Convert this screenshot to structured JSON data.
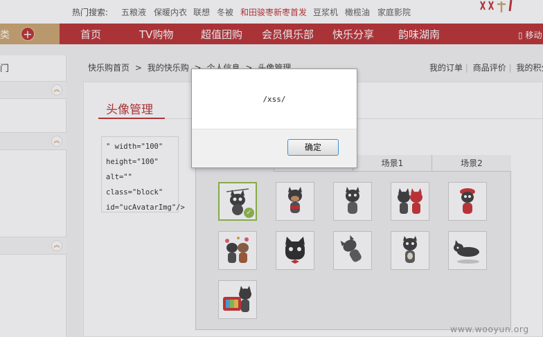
{
  "hotbar": {
    "label": "热门搜索:",
    "links": [
      "五粮液",
      "保暖内衣",
      "联想",
      "冬被",
      "和田骏枣新枣首发",
      "豆浆机",
      "橄榄油",
      "家庭影院"
    ]
  },
  "navbar": {
    "category_text": "类",
    "plus": "+",
    "items": [
      "首页",
      "TV购物",
      "超值团购",
      "会员俱乐部",
      "快乐分享",
      "韵味湖南"
    ],
    "mobile": "移动"
  },
  "sidebar": {
    "title": "门",
    "chevron": "︽"
  },
  "breadcrumb": {
    "items": [
      "快乐购首页",
      "我的快乐购",
      "个人信息",
      "头像管理"
    ],
    "separator": ">"
  },
  "toplinks": {
    "items": [
      "我的订单",
      "商品评价",
      "我的积分"
    ],
    "separator": "|"
  },
  "content": {
    "title": "头像管理",
    "code_lines": [
      "\" width=\"100\"",
      "height=\"100\"",
      "alt=\"\"",
      "class=\"block\"",
      "id=\"ucAvatarImg\"/>"
    ],
    "tabs": [
      "场景1",
      "场景2"
    ],
    "check_glyph": "✓"
  },
  "dialog": {
    "message": "/xss/",
    "ok_label": "确定"
  },
  "watermark": "www.wooyun.org",
  "colors": {
    "brand_red": "#b8272a",
    "nav_gold": "#c8a26a",
    "selected_green": "#8bb83e",
    "button_focus_blue": "#3c8dd8"
  }
}
